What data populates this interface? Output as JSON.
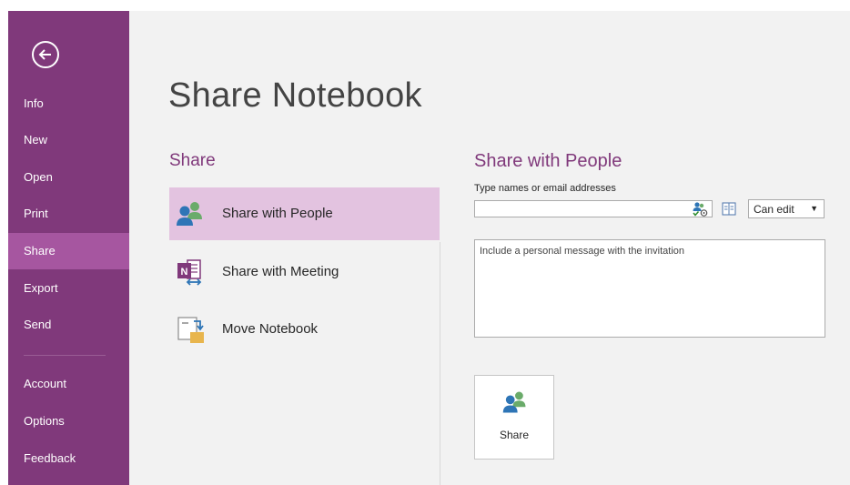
{
  "sidebar": {
    "back_icon": "back-arrow-icon",
    "items": [
      {
        "label": "Info"
      },
      {
        "label": "New"
      },
      {
        "label": "Open"
      },
      {
        "label": "Print"
      },
      {
        "label": "Share",
        "selected": true
      },
      {
        "label": "Export"
      },
      {
        "label": "Send"
      },
      {
        "label": "Account"
      },
      {
        "label": "Options"
      },
      {
        "label": "Feedback"
      }
    ]
  },
  "main": {
    "page_title": "Share Notebook",
    "section_title": "Share",
    "options": [
      {
        "label": "Share with People",
        "icon": "people-icon",
        "selected": true
      },
      {
        "label": "Share with Meeting",
        "icon": "onenote-meeting-icon"
      },
      {
        "label": "Move Notebook",
        "icon": "move-notebook-icon"
      }
    ]
  },
  "detail": {
    "title": "Share with People",
    "names_label": "Type names or email addresses",
    "names_value": "",
    "permission": "Can edit",
    "message_placeholder": "Include a personal message with the invitation",
    "share_button_label": "Share",
    "share_button_icon": "people-icon"
  },
  "colors": {
    "sidebar_bg": "#80397b",
    "sidebar_selected": "#a656a0",
    "accent": "#80397b",
    "option_selected": "#e3c3e0",
    "main_bg": "#f2f2f2"
  }
}
